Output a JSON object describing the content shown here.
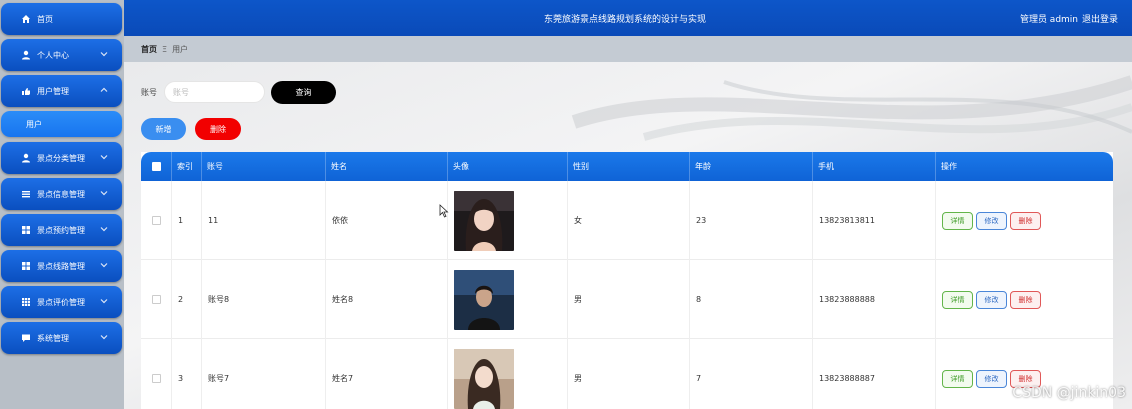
{
  "sidebar": {
    "items": [
      {
        "label": "首页",
        "icon": "home-icon"
      },
      {
        "label": "个人中心",
        "icon": "user-icon"
      },
      {
        "label": "用户管理",
        "icon": "users-manage-icon"
      },
      {
        "label": "景点分类管理",
        "icon": "user-icon"
      },
      {
        "label": "景点信息管理",
        "icon": "list-icon"
      },
      {
        "label": "景点预约管理",
        "icon": "grid-icon"
      },
      {
        "label": "景点线路管理",
        "icon": "grid-icon"
      },
      {
        "label": "景点评价管理",
        "icon": "table-icon"
      },
      {
        "label": "系统管理",
        "icon": "message-icon"
      }
    ],
    "submenu_active": "用户"
  },
  "header": {
    "title": "东莞旅游景点线路规划系统的设计与实现",
    "user": "管理员 admin",
    "logout": "退出登录"
  },
  "breadcrumb": {
    "home": "首页",
    "separator": "Ξ",
    "current": "用户"
  },
  "search": {
    "label": "账号",
    "placeholder": "账号",
    "query_button": "查询"
  },
  "actions": {
    "add": "新增",
    "delete": "删除"
  },
  "table": {
    "columns": [
      "索引",
      "账号",
      "姓名",
      "头像",
      "性别",
      "年龄",
      "手机",
      "操作"
    ],
    "rows": [
      {
        "index": "1",
        "account": "11",
        "name": "依依",
        "gender": "女",
        "age": "23",
        "phone": "13823813811"
      },
      {
        "index": "2",
        "account": "账号8",
        "name": "姓名8",
        "gender": "男",
        "age": "8",
        "phone": "13823888888"
      },
      {
        "index": "3",
        "account": "账号7",
        "name": "姓名7",
        "gender": "男",
        "age": "7",
        "phone": "13823888887"
      }
    ],
    "op_labels": {
      "detail": "详情",
      "edit": "修改",
      "delete": "删除"
    }
  },
  "watermark": "CSDN @jinkin03",
  "colors": {
    "header_blue": "#0d56c9",
    "table_header_blue": "#1b79ea",
    "delete_red": "#f20000",
    "add_blue": "#3a8ef0"
  }
}
